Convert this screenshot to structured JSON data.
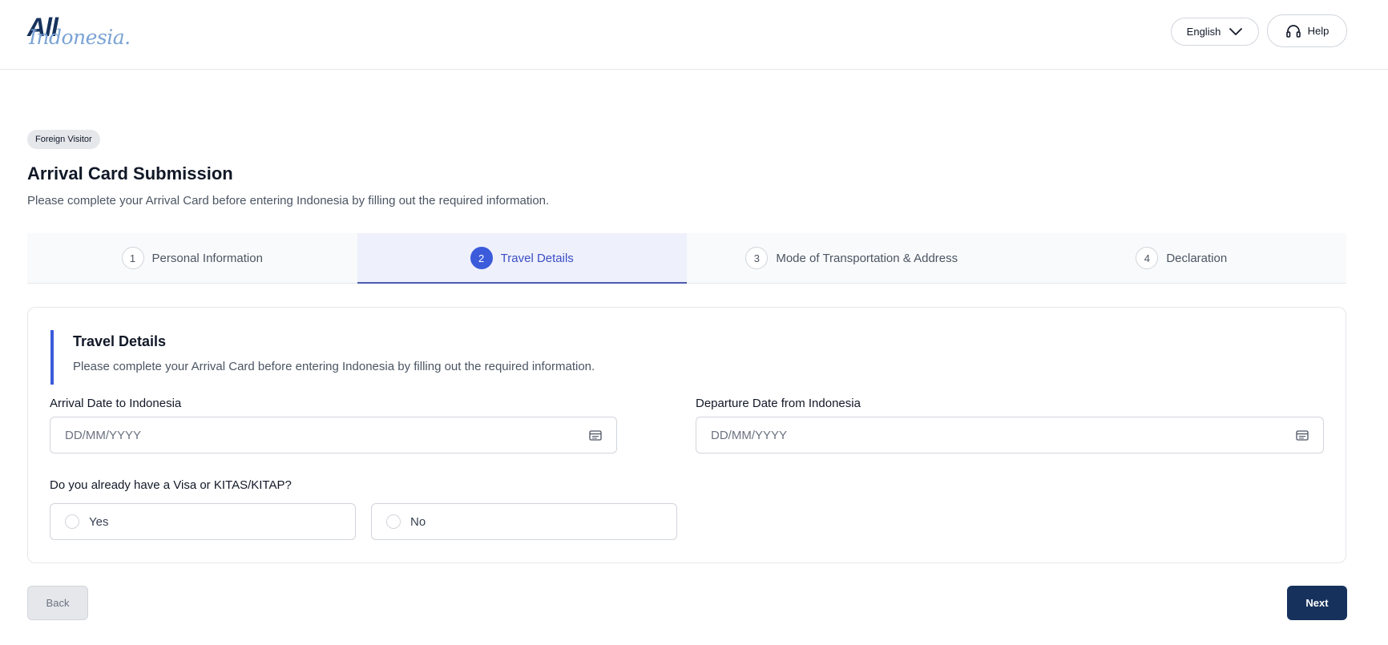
{
  "header": {
    "logo_main": "All",
    "logo_script": "Indonesia.",
    "language": "English",
    "help_label": "Help"
  },
  "badge": "Foreign Visitor",
  "page": {
    "title": "Arrival Card Submission",
    "subtitle": "Please complete your Arrival Card before entering Indonesia by filling out the required information."
  },
  "stepper": {
    "active_step": 2,
    "steps": [
      {
        "number": "1",
        "label": "Personal Information"
      },
      {
        "number": "2",
        "label": "Travel Details"
      },
      {
        "number": "3",
        "label": "Mode of Transportation & Address"
      },
      {
        "number": "4",
        "label": "Declaration"
      }
    ]
  },
  "section": {
    "title": "Travel Details",
    "description": "Please complete your Arrival Card before entering Indonesia by filling out the required information."
  },
  "form": {
    "arrival_label": "Arrival Date to Indonesia",
    "arrival_placeholder": "DD/MM/YYYY",
    "arrival_value": "",
    "departure_label": "Departure Date from Indonesia",
    "departure_placeholder": "DD/MM/YYYY",
    "departure_value": "",
    "visa_question": "Do you already have a Visa or KITAS/KITAP?",
    "visa_options": [
      {
        "label": "Yes",
        "selected": false
      },
      {
        "label": "No",
        "selected": false
      }
    ]
  },
  "footer": {
    "back_label": "Back",
    "next_label": "Next"
  },
  "colors": {
    "brand_navy": "#16325c",
    "accent_blue": "#3b5bdb",
    "active_step_bg": "#eef0fb"
  },
  "icons": {
    "language_dropdown": "chevron-down-icon",
    "help": "headset-icon",
    "date_picker": "calendar-icon"
  }
}
